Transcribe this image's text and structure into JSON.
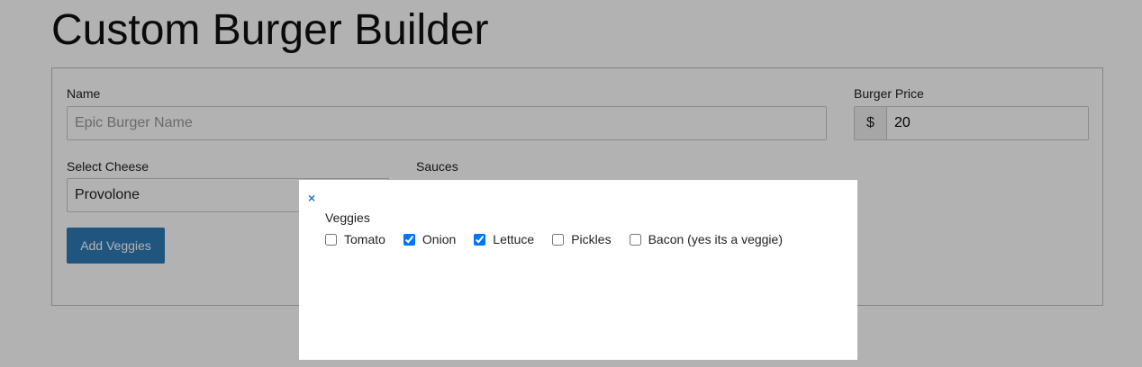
{
  "page": {
    "title": "Custom Burger Builder"
  },
  "form": {
    "name_label": "Name",
    "name_placeholder": "Epic Burger Name",
    "name_value": "",
    "price_label": "Burger Price",
    "price_currency": "$",
    "price_value": "20",
    "cheese_label": "Select Cheese",
    "cheese_selected": "Provolone",
    "sauces_label": "Sauces",
    "add_veggies_label": "Add Veggies"
  },
  "modal": {
    "close_symbol": "×",
    "title": "Veggies",
    "options": [
      {
        "label": "Tomato",
        "checked": false
      },
      {
        "label": "Onion",
        "checked": true
      },
      {
        "label": "Lettuce",
        "checked": true
      },
      {
        "label": "Pickles",
        "checked": false
      },
      {
        "label": "Bacon (yes its a veggie)",
        "checked": false
      }
    ]
  },
  "colors": {
    "accent": "#2e7ab6",
    "overlay": "rgba(0,0,0,0.30)"
  }
}
